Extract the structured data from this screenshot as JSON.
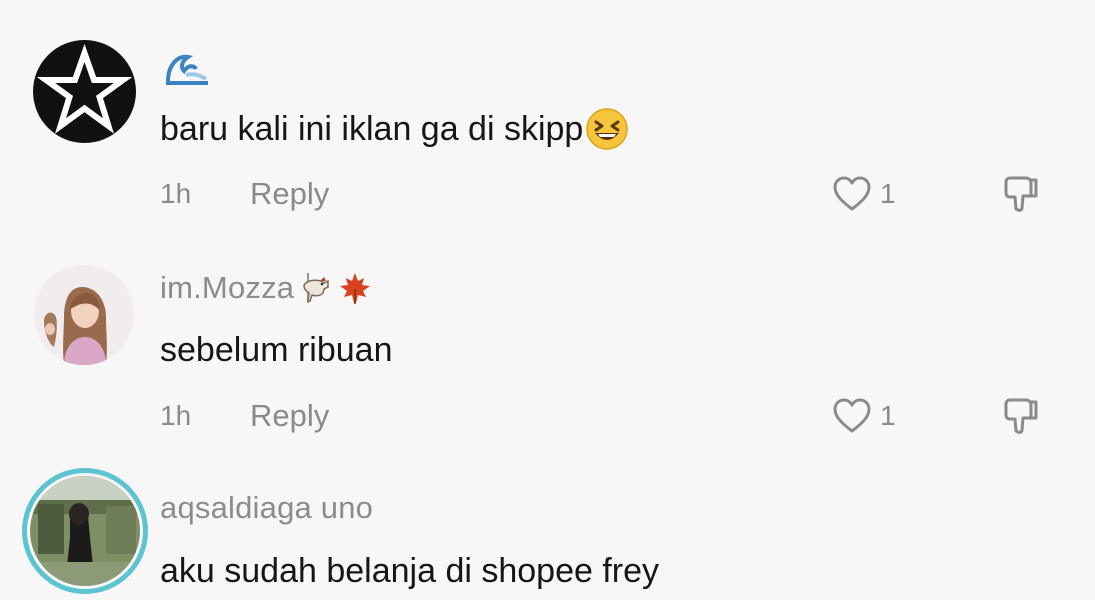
{
  "comments": [
    {
      "username": "",
      "username_emoji": "wave-emoji",
      "text": "baru kali ini iklan ga di skipp",
      "text_emoji": "laughing-emoji",
      "time": "1h",
      "reply_label": "Reply",
      "likes": "1",
      "avatar": "star-logo"
    },
    {
      "username": "im.Mozza",
      "username_emoji": "carousel-horse-and-maple-leaf-emoji",
      "text": "sebelum ribuan",
      "time": "1h",
      "reply_label": "Reply",
      "likes": "1",
      "avatar": "girl-photo"
    },
    {
      "username": "aqsaldiaga uno",
      "text": "aku sudah belanja di shopee frey",
      "avatar": "outdoor-photo-with-story-ring"
    }
  ],
  "colors": {
    "background": "#f7f7f7",
    "text": "#161616",
    "muted": "#8a8a8a",
    "story_ring": "#5cc4d0"
  }
}
